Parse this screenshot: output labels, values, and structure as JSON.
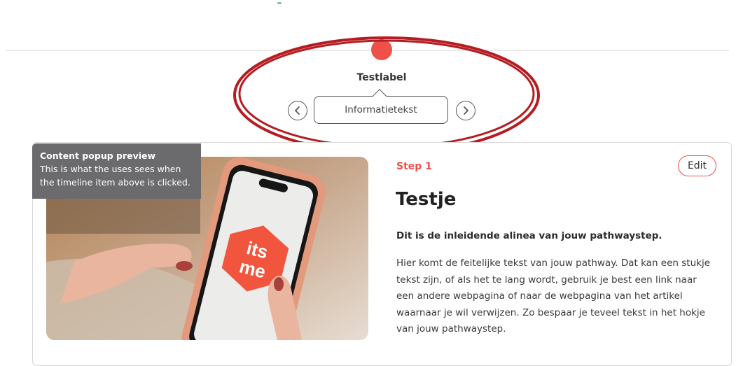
{
  "timeline": {
    "label": "Testlabel",
    "info_text": "Informatietekst",
    "dot_color": "#f0504a",
    "prev_icon": "chevron-left-icon",
    "next_icon": "chevron-right-icon"
  },
  "annotation": {
    "color": "#b51d22",
    "shape": "ellipse"
  },
  "preview_tooltip": {
    "title": "Content popup preview",
    "line1": "This is what the uses sees when",
    "line2": "the timeline item above is clicked."
  },
  "card": {
    "image_logo_line1": "its",
    "image_logo_line2": "me",
    "step_label": "Step 1",
    "edit_label": "Edit",
    "title": "Testje",
    "intro": "Dit is de inleidende alinea van jouw pathwaystep.",
    "body": "Hier komt de feitelijke tekst van jouw pathway. Dat kan een stukje tekst zijn, of als het te lang wordt, gebruik je best een link naar een andere webpagina of naar de webpagina van het artikel waarnaar je wil verwijzen. Zo bespaar je teveel tekst in het hokje van jouw pathwaystep."
  },
  "colors": {
    "accent": "#f0504a",
    "tooltip_bg": "#6b6b6e",
    "border": "#555555"
  }
}
